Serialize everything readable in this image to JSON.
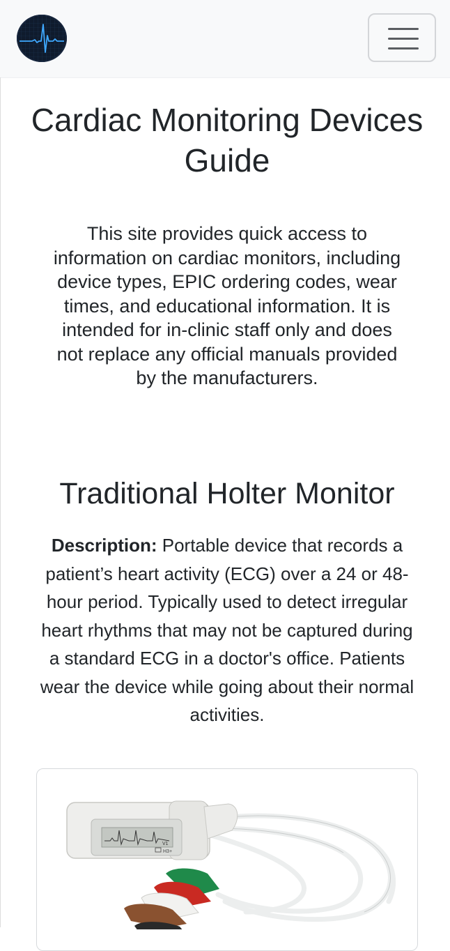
{
  "navbar": {
    "logo_icon": "heart-rate-ecg-logo-icon",
    "toggler_icon": "hamburger-menu-icon",
    "colors": {
      "background": "#f8f9fa",
      "logo_bg": "#0f1b2d",
      "logo_line": "#3fa9ff"
    }
  },
  "page": {
    "title": "Cardiac Monitoring Devices Guide",
    "intro": "This site provides quick access to information on cardiac monitors, including device types, EPIC ordering codes, wear times, and educational information. It is intended for in-clinic staff only and does not replace any official manuals provided by the manufacturers."
  },
  "device": {
    "name": "Traditional Holter Monitor",
    "description_label": "Description:",
    "description_text": " Portable device that records a patient’s heart activity (ECG) over a 24 or 48-hour period. Typically used to detect irregular heart rhythms that may not be captured during a standard ECG in a doctor's office. Patients wear the device while going about their normal activities.",
    "image": {
      "screen_label": "V1",
      "badge_label": "H3+"
    }
  }
}
